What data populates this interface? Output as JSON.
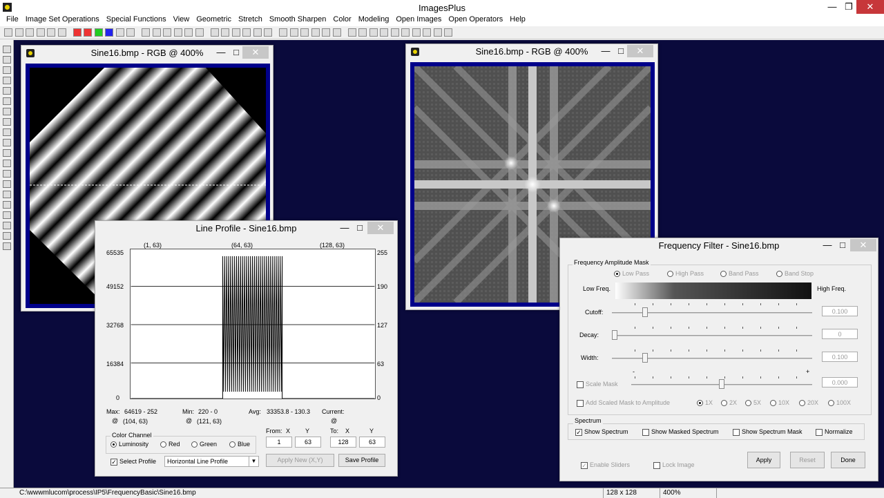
{
  "app": {
    "title": "ImagesPlus"
  },
  "menu": [
    "File",
    "Image Set Operations",
    "Special Functions",
    "View",
    "Geometric",
    "Stretch",
    "Smooth Sharpen",
    "Color",
    "Modeling",
    "Open Images",
    "Open Operators",
    "Help"
  ],
  "status": {
    "path": "C:\\wwwmlucom\\process\\IP5\\FrequencyBasic\\Sine16.bmp",
    "size": "128 x 128",
    "zoom": "400%"
  },
  "win1": {
    "title": "Sine16.bmp - RGB @ 400%"
  },
  "win2": {
    "title": "Sine16.bmp - RGB @ 400%"
  },
  "profile": {
    "title": "Line Profile - Sine16.bmp",
    "top_labels": [
      "(1, 63)",
      "(64, 63)",
      "(128, 63)"
    ],
    "left_axis": [
      "65535",
      "49152",
      "32768",
      "16384",
      "0"
    ],
    "right_axis": [
      "255",
      "190",
      "127",
      "63",
      "0"
    ],
    "max_label": "Max:",
    "max_value": "64619 - 252",
    "max_at": "@",
    "max_pos": "(104, 63)",
    "min_label": "Min:",
    "min_value": "220 - 0",
    "min_at": "@",
    "min_pos": "(121, 63)",
    "avg_label": "Avg:",
    "avg_value": "33353.8 - 130.3",
    "current_label": "Current:",
    "current_at": "@",
    "color_channel": "Color Channel",
    "channels": [
      "Luminosity",
      "Red",
      "Green",
      "Blue"
    ],
    "from_label": "From:",
    "to_label": "To:",
    "x_label": "X",
    "y_label": "Y",
    "from_x": "1",
    "from_y": "63",
    "to_x": "128",
    "to_y": "63",
    "select_profile": "Select Profile",
    "profile_type": "Horizontal Line Profile",
    "apply_new": "Apply New (X,Y)",
    "save_profile": "Save Profile"
  },
  "filter": {
    "title": "Frequency Filter - Sine16.bmp",
    "group": "Frequency Amplitude Mask",
    "modes": [
      "Low Pass",
      "High Pass",
      "Band Pass",
      "Band Stop"
    ],
    "low_freq": "Low Freq.",
    "high_freq": "High Freq.",
    "cutoff_label": "Cutoff:",
    "cutoff_value": "0.100",
    "cutoff_level": 0.08,
    "decay_label": "Decay:",
    "decay_value": "0",
    "decay_level": 0.0,
    "width_label": "Width:",
    "width_value": "0.100",
    "width_level": 0.08,
    "scale_mask": "Scale Mask",
    "scale_value": "0.000",
    "scale_level": 0.5,
    "scale_minus": "-",
    "scale_plus": "+",
    "add_scaled": "Add Scaled Mask to Amplitude",
    "multipliers": [
      "1X",
      "2X",
      "5X",
      "10X",
      "20X",
      "100X"
    ],
    "spectrum_group": "Spectrum",
    "show_spectrum": "Show Spectrum",
    "show_masked": "Show Masked Spectrum",
    "show_mask": "Show Spectrum Mask",
    "normalize": "Normalize",
    "enable_sliders": "Enable Sliders",
    "lock_image": "Lock Image",
    "apply": "Apply",
    "reset": "Reset",
    "done": "Done"
  }
}
